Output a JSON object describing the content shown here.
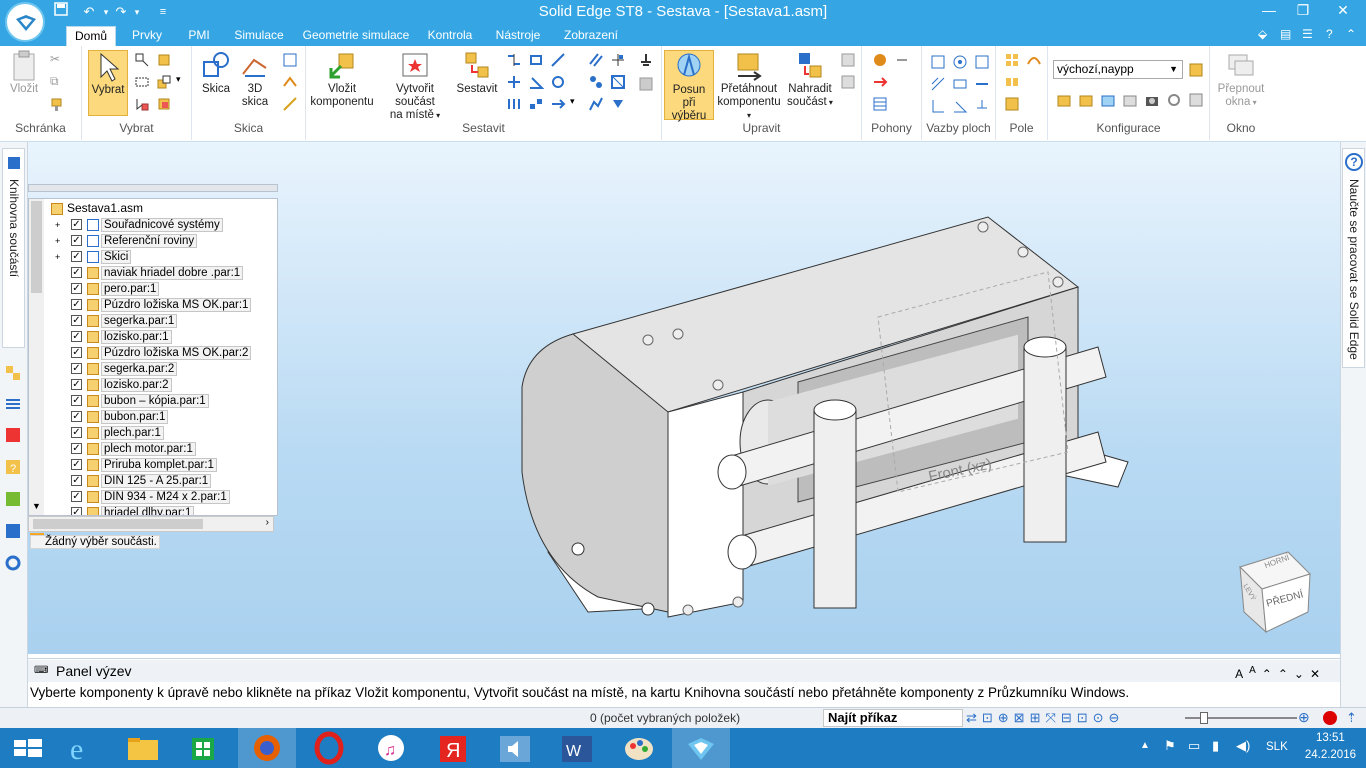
{
  "window": {
    "title": "Solid Edge ST8 - Sestava - [Sestava1.asm]",
    "controls": {
      "minimize": "—",
      "restore": "❐",
      "close": "✕"
    }
  },
  "quick_access": {
    "save_icon": "save-icon",
    "undo_icon": "undo-icon",
    "redo_icon": "redo-icon"
  },
  "tabs": [
    "Domů",
    "Prvky",
    "PMI",
    "Simulace",
    "Geometrie simulace",
    "Kontrola",
    "Nástroje",
    "Zobrazení"
  ],
  "active_tab": "Domů",
  "ribbon": {
    "groups": {
      "clipboard": "Schránka",
      "select": "Vybrat",
      "sketch": "Skica",
      "assemble": "Sestavit",
      "modify": "Upravit",
      "drives": "Pohony",
      "face_relations": "Vazby ploch",
      "pole": "Pole",
      "configuration": "Konfigurace",
      "window": "Okno"
    },
    "buttons": {
      "paste": "Vložit",
      "select": "Vybrat",
      "sketch": "Skica",
      "sketch3d_line1": "3D",
      "sketch3d_line2": "skica",
      "insert_component_line1": "Vložit",
      "insert_component_line2": "komponentu",
      "create_in_place_line1": "Vytvořit součást",
      "create_in_place_line2": "na místě",
      "assemble": "Sestavit",
      "move_selection_line1": "Posun při",
      "move_selection_line2": "výběru",
      "drag_component_line1": "Přetáhnout",
      "drag_component_line2": "komponentu",
      "replace_part_line1": "Nahradit",
      "replace_part_line2": "součást",
      "switch_windows_line1": "Přepnout",
      "switch_windows_line2": "okna"
    },
    "config_select_value": "výchozí,naypp"
  },
  "pathfinder": {
    "root": "Sestava1.asm",
    "items": [
      {
        "label": "Souřadnicové systémy",
        "expand": true
      },
      {
        "label": "Referenční roviny",
        "expand": true
      },
      {
        "label": "Skici",
        "expand": true
      },
      {
        "label": "naviak hriadel dobre .par:1",
        "expand": false
      },
      {
        "label": "pero.par:1",
        "expand": false
      },
      {
        "label": "Púzdro ložiska MS OK.par:1",
        "expand": false
      },
      {
        "label": "segerka.par:1",
        "expand": false
      },
      {
        "label": "lozisko.par:1",
        "expand": false
      },
      {
        "label": "Púzdro ložiska MS OK.par:2",
        "expand": false
      },
      {
        "label": "segerka.par:2",
        "expand": false
      },
      {
        "label": "lozisko.par:2",
        "expand": false
      },
      {
        "label": "bubon – kópia.par:1",
        "expand": false
      },
      {
        "label": "bubon.par:1",
        "expand": false
      },
      {
        "label": "plech.par:1",
        "expand": false
      },
      {
        "label": "plech motor.par:1",
        "expand": false
      },
      {
        "label": "Priruba komplet.par:1",
        "expand": false
      },
      {
        "label": "DIN 125 - A 25.par:1",
        "expand": false
      },
      {
        "label": "DIN 934 - M24 x 2.par:1",
        "expand": false
      },
      {
        "label": "hriadel dlhy.par:1",
        "expand": false
      }
    ],
    "selection_info": "Žádný výběr součásti."
  },
  "left_tab_label": "Knihovna součástí",
  "right_tab_label": "Naučte se pracovat se Solid Edge",
  "viewport": {
    "plane_label": "Front (xz)",
    "view_cube": {
      "top": "HORNÍ",
      "front": "PŘEDNÍ",
      "left": "LEVÝ"
    }
  },
  "prompt": {
    "title": "Panel výzev",
    "message": "Vyberte komponenty k úpravě nebo klikněte na příkaz Vložit komponentu, Vytvořit součást na místě, na kartu Knihovna součástí nebo přetáhněte komponenty z Průzkumníku Windows."
  },
  "status": {
    "selected_count": "0 (počet vybraných položek)",
    "find_command_label": "Najít příkaz"
  },
  "taskbar": {
    "apps": [
      "start-icon",
      "internet-explorer-icon",
      "file-explorer-icon",
      "store-icon",
      "firefox-icon",
      "opera-icon",
      "itunes-icon",
      "yandex-icon",
      "speaker-app-icon",
      "word-icon",
      "paint-icon",
      "solid-edge-icon"
    ],
    "active_app": "solid-edge-icon",
    "language": "SLK",
    "time": "13:51",
    "date": "24.2.2016"
  },
  "colors": {
    "titlebar": "#35a6e3",
    "taskbar": "#1d7cc2",
    "accent": "#f5c342"
  }
}
